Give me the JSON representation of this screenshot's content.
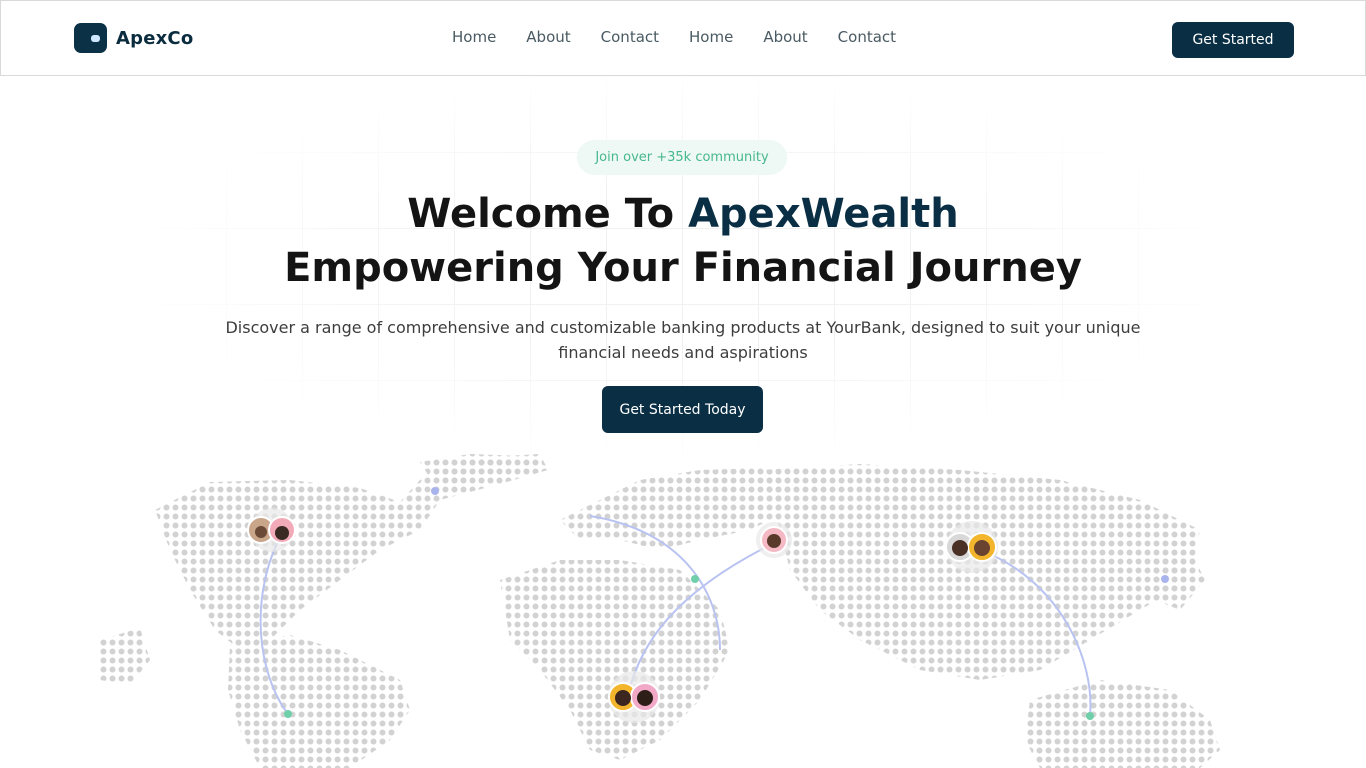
{
  "brand": {
    "name": "ApexCo"
  },
  "nav": {
    "items": [
      "Home",
      "About",
      "Contact",
      "Home",
      "About",
      "Contact"
    ]
  },
  "header": {
    "cta_label": "Get Started"
  },
  "hero": {
    "badge": "Join over +35k community",
    "title_line1_prefix": "Welcome To ",
    "title_line1_accent": "ApexWealth",
    "title_line2": "Empowering Your Financial Journey",
    "subtitle": "Discover a range of comprehensive and customizable banking products at YourBank, designed to suit your unique financial needs and aspirations",
    "cta_label": "Get Started Today"
  },
  "colors": {
    "primary": "#0a2f45",
    "accent_green": "#46b88f",
    "badge_bg": "#eef8f4",
    "map_dot": "#d2d2d2",
    "arc": "#b9c3f2"
  }
}
